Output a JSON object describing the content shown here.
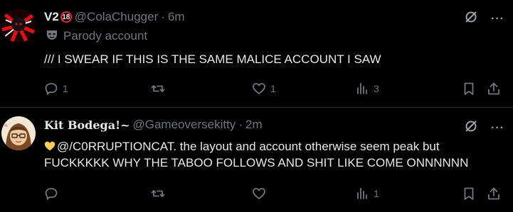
{
  "tweets": [
    {
      "name": "V2",
      "age_badge": "18",
      "handle": "@ColaChugger",
      "separator": "·",
      "time": "6m",
      "parody_label": "Parody account",
      "text": "/// I SWEAR IF THIS IS THE SAME MALICE ACCOUNT I SAW",
      "replies": "1",
      "reposts": "",
      "likes": "1",
      "views": "3"
    },
    {
      "name": "Kit Bodega!~",
      "handle": "@Gameoversekitty",
      "separator": "·",
      "time": "2m",
      "text_line1": "@/C0RRUPTIONCAT. the layout and account otherwise seem peak but",
      "text_line2": "FUCKKKKK WHY THE TABOO FOLLOWS AND SHIT LIKE COME ONNNNNN",
      "replies": "",
      "reposts": "",
      "likes": "",
      "views": "1"
    }
  ],
  "icons": {
    "reply": "reply-icon",
    "repost": "repost-icon",
    "like": "heart-icon",
    "views": "views-icon",
    "bookmark": "bookmark-icon",
    "share": "share-icon",
    "grok": "grok-icon",
    "more": "more-icon",
    "parody": "mask-icon",
    "emoji": "yellow-heart-emoji"
  },
  "colors": {
    "background": "#000000",
    "text": "#e7e9ea",
    "muted": "#71767b",
    "divider": "#2f3336",
    "badge": "#f4212e"
  },
  "more_glyph": "···"
}
